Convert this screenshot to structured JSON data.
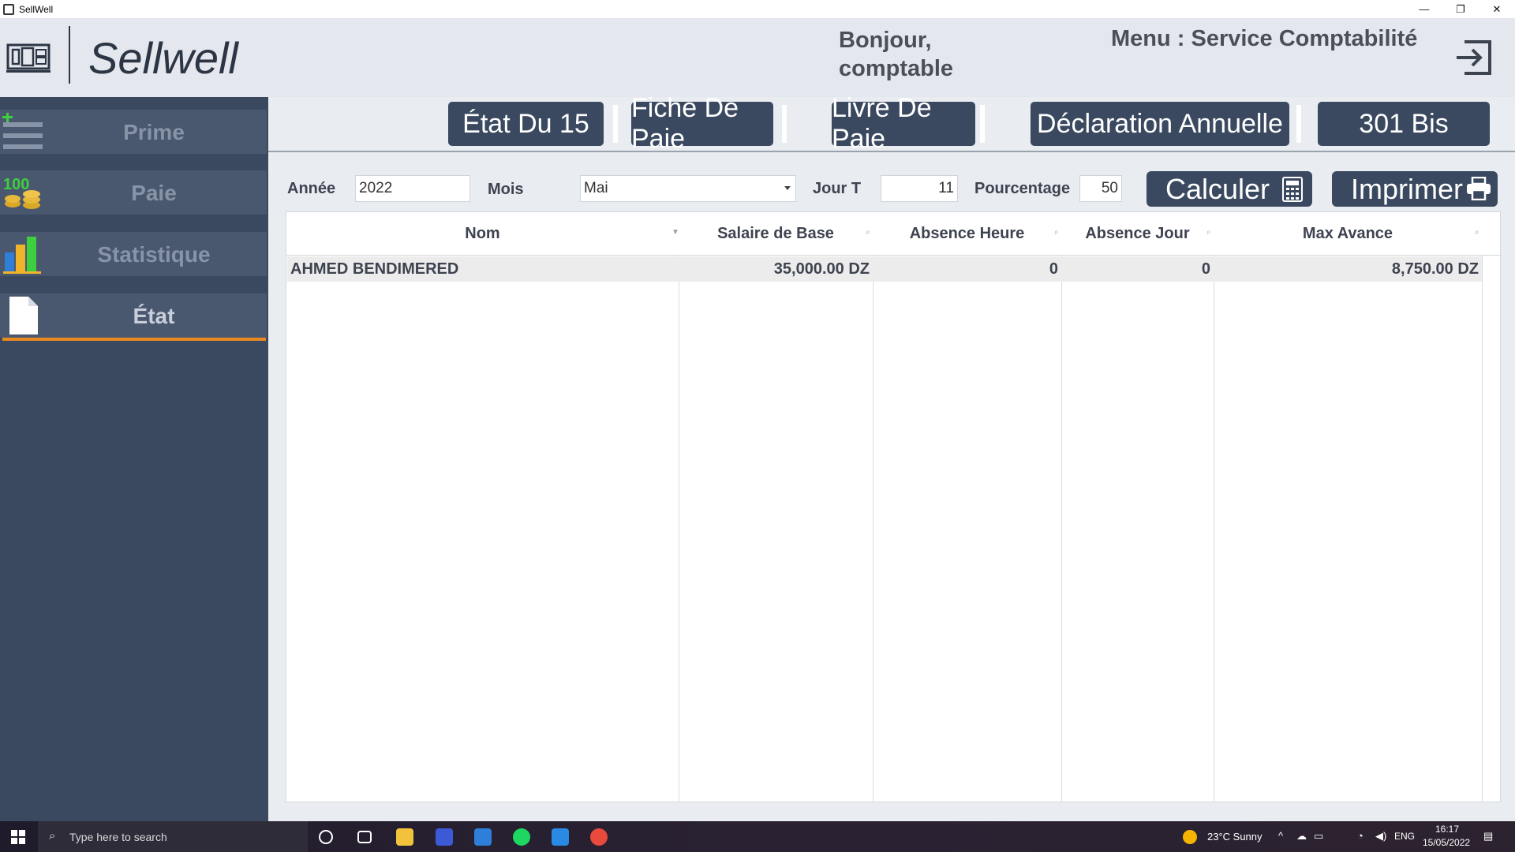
{
  "window": {
    "title": "SellWell",
    "minimize": "—",
    "restore": "❐",
    "close": "✕"
  },
  "header": {
    "logo_text": "Sellwell",
    "greeting": "Bonjour, comptable",
    "menu_title": "Menu : Service Comptabilité"
  },
  "sidebar": {
    "items": [
      {
        "label": "Prime",
        "icon": "prime-icon"
      },
      {
        "label": "Paie",
        "icon": "coins-icon"
      },
      {
        "label": "Statistique",
        "icon": "bar-chart-icon"
      },
      {
        "label": "État",
        "icon": "document-icon"
      }
    ],
    "active": "État"
  },
  "tabs": [
    {
      "label": "État Du 15"
    },
    {
      "label": "Fiche De Paie"
    },
    {
      "label": "Livre De Paie"
    },
    {
      "label": "Déclaration Annuelle"
    },
    {
      "label": "301 Bis"
    }
  ],
  "filters": {
    "annee_label": "Année",
    "annee_value": "2022",
    "mois_label": "Mois",
    "mois_value": "Mai",
    "jour_label": "Jour T",
    "jour_value": "11",
    "pourcentage_label": "Pourcentage",
    "pourcentage_value": "50"
  },
  "actions": {
    "calculer": "Calculer",
    "imprimer": "Imprimer"
  },
  "table": {
    "columns": [
      "Nom",
      "Salaire de Base",
      "Absence Heure",
      "Absence Jour",
      "Max Avance"
    ],
    "rows": [
      [
        "AHMED BENDIMERED",
        "35,000.00 DZ",
        "0",
        "0",
        "8,750.00 DZ"
      ]
    ]
  },
  "taskbar": {
    "search_placeholder": "Type here to search",
    "weather": "23°C  Sunny",
    "lang": "ENG",
    "time": "16:17",
    "date": "15/05/2022"
  },
  "colors": {
    "sidebar": "#3a4960",
    "accent": "#e98a1f",
    "button": "#3a4960"
  }
}
